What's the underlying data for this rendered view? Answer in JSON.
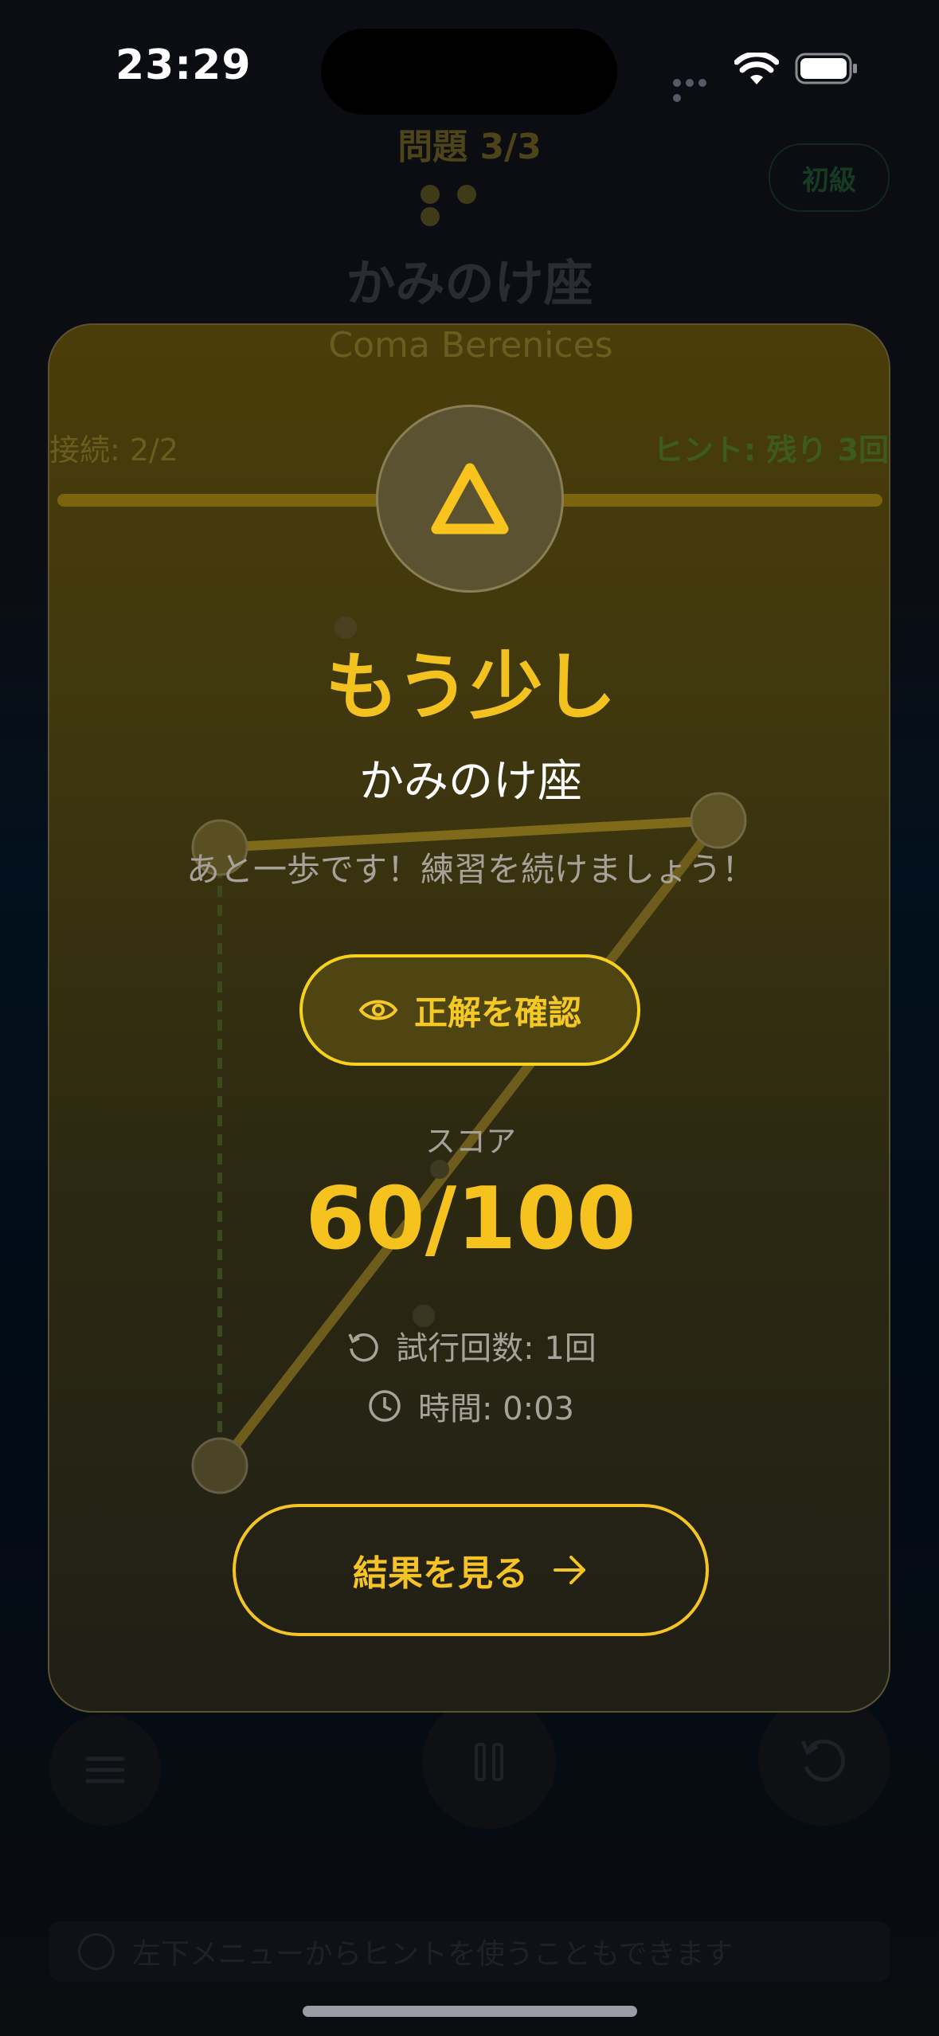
{
  "status_bar": {
    "time": "23:29"
  },
  "background": {
    "problem_label": "問題 3/3",
    "level_badge": "初級",
    "title": "かみのけ座",
    "tip_text": "左下メニューからヒントを使うこともできます"
  },
  "modal": {
    "subtitle_behind": "Coma Berenices",
    "connections_behind": "接続: 2/2",
    "hints_behind": "ヒント: 残り 3回",
    "icon": "warning-triangle-icon",
    "headline": "もう少し",
    "constellation_name": "かみのけ座",
    "message": "あと一歩です！練習を続けましょう！",
    "confirm_button": {
      "label": "正解を確認",
      "icon": "eye-icon"
    },
    "score_label": "スコア",
    "score_value": "60/100",
    "attempts": {
      "icon": "retry-icon",
      "text": "試行回数: 1回"
    },
    "time": {
      "icon": "clock-icon",
      "text": "時間: 0:03"
    },
    "result_button": {
      "label": "結果を見る",
      "icon": "arrow-right-icon"
    }
  },
  "colors": {
    "accent": "#F5C424",
    "modal_bg": "#3F370E",
    "muted_text": "#A6A29A"
  }
}
